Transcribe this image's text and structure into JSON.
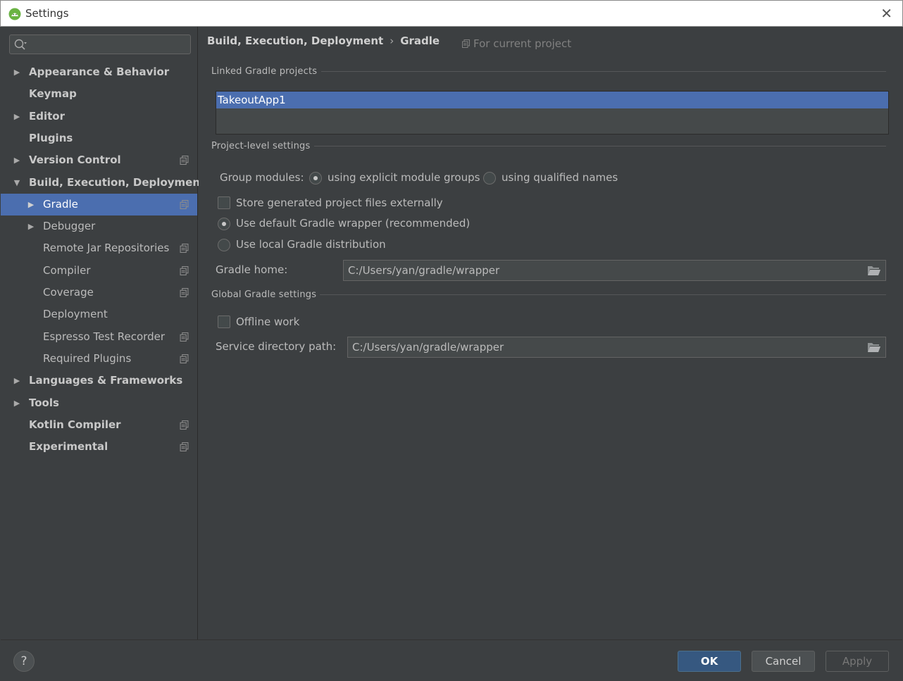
{
  "window": {
    "title": "Settings"
  },
  "sidebar": {
    "search": {
      "value": "",
      "placeholder": ""
    },
    "items": [
      {
        "label": "Appearance & Behavior",
        "level": 0,
        "arrow": "collapsed",
        "project_icon": false
      },
      {
        "label": "Keymap",
        "level": 0,
        "arrow": "none",
        "project_icon": false
      },
      {
        "label": "Editor",
        "level": 0,
        "arrow": "collapsed",
        "project_icon": false
      },
      {
        "label": "Plugins",
        "level": 0,
        "arrow": "none",
        "project_icon": false
      },
      {
        "label": "Version Control",
        "level": 0,
        "arrow": "collapsed",
        "project_icon": true
      },
      {
        "label": "Build, Execution, Deployment",
        "level": 0,
        "arrow": "expanded",
        "project_icon": false
      },
      {
        "label": "Gradle",
        "level": 1,
        "arrow": "collapsed",
        "project_icon": true,
        "selected": true
      },
      {
        "label": "Debugger",
        "level": 1,
        "arrow": "collapsed",
        "project_icon": false
      },
      {
        "label": "Remote Jar Repositories",
        "level": 1,
        "arrow": "none",
        "project_icon": true
      },
      {
        "label": "Compiler",
        "level": 1,
        "arrow": "none",
        "project_icon": true
      },
      {
        "label": "Coverage",
        "level": 1,
        "arrow": "none",
        "project_icon": true
      },
      {
        "label": "Deployment",
        "level": 1,
        "arrow": "none",
        "project_icon": false
      },
      {
        "label": "Espresso Test Recorder",
        "level": 1,
        "arrow": "none",
        "project_icon": true
      },
      {
        "label": "Required Plugins",
        "level": 1,
        "arrow": "none",
        "project_icon": true
      },
      {
        "label": "Languages & Frameworks",
        "level": 0,
        "arrow": "collapsed",
        "project_icon": false
      },
      {
        "label": "Tools",
        "level": 0,
        "arrow": "collapsed",
        "project_icon": false
      },
      {
        "label": "Kotlin Compiler",
        "level": 0,
        "arrow": "none",
        "project_icon": true
      },
      {
        "label": "Experimental",
        "level": 0,
        "arrow": "none",
        "project_icon": true
      }
    ]
  },
  "breadcrumb": {
    "parent": "Build, Execution, Deployment",
    "current": "Gradle",
    "separator": "›",
    "scope": "For current project"
  },
  "linked": {
    "title": "Linked Gradle projects",
    "projects": [
      "TakeoutApp1"
    ]
  },
  "project_level": {
    "title": "Project-level settings",
    "group_modules_label": "Group modules:",
    "group_option_explicit": "using explicit module groups",
    "group_option_qualified": "using qualified names",
    "group_selected": "explicit",
    "store_externally_label": "Store generated project files externally",
    "store_externally_checked": false,
    "wrapper_label": "Use default Gradle wrapper (recommended)",
    "local_label": "Use local Gradle distribution",
    "distribution_selected": "wrapper",
    "gradle_home_label": "Gradle home:",
    "gradle_home_value": "C:/Users/yan/gradle/wrapper"
  },
  "global": {
    "title": "Global Gradle settings",
    "offline_label": "Offline work",
    "offline_checked": false,
    "service_dir_label": "Service directory path:",
    "service_dir_value": "C:/Users/yan/gradle/wrapper"
  },
  "footer": {
    "help": "?",
    "ok": "OK",
    "cancel": "Cancel",
    "apply": "Apply"
  },
  "colors": {
    "background": "#3c3f41",
    "selection": "#4b6eaf",
    "ok_button": "#365880",
    "field": "#45494a"
  }
}
